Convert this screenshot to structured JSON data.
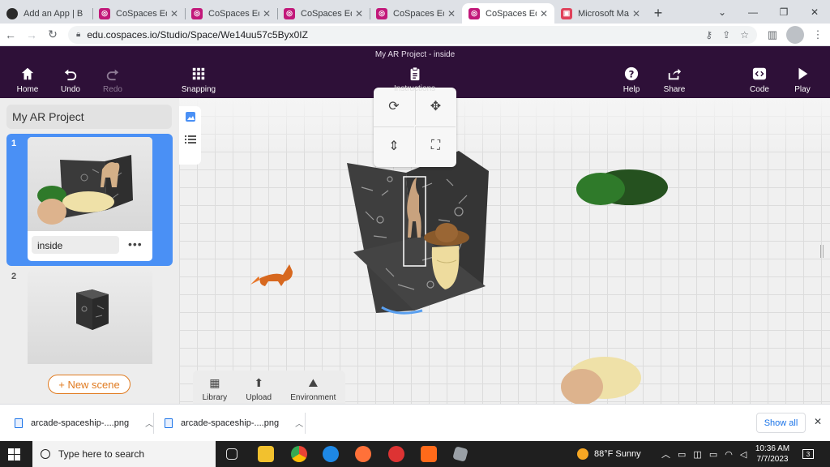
{
  "browser": {
    "tabs": [
      {
        "title": "Add an App | B",
        "favicon": "app-icon",
        "active": false
      },
      {
        "title": "CoSpaces Edu",
        "favicon": "cospaces-icon",
        "active": false
      },
      {
        "title": "CoSpaces Edu",
        "favicon": "cospaces-icon",
        "active": false
      },
      {
        "title": "CoSpaces Edu",
        "favicon": "cospaces-icon",
        "active": false
      },
      {
        "title": "CoSpaces Edu",
        "favicon": "cospaces-icon",
        "active": false
      },
      {
        "title": "CoSpaces Edu",
        "favicon": "cospaces-icon",
        "active": true
      },
      {
        "title": "Microsoft Mak",
        "favicon": "microsoft-icon",
        "active": false
      }
    ],
    "url": "edu.cospaces.io/Studio/Space/We14uu57c5Byx0IZ"
  },
  "header": {
    "project_scene_title": "My AR Project - inside",
    "home": "Home",
    "undo": "Undo",
    "redo": "Redo",
    "snapping": "Snapping",
    "instructions": "Instructions",
    "help": "Help",
    "share": "Share",
    "code": "Code",
    "play": "Play"
  },
  "left_panel": {
    "project_title": "My AR Project",
    "scenes": [
      {
        "number": "1",
        "name": "inside",
        "selected": true
      },
      {
        "number": "2",
        "name": "",
        "selected": false
      }
    ],
    "new_scene": "+ New scene"
  },
  "bottom_bar": {
    "library": "Library",
    "upload": "Upload",
    "environment": "Environment"
  },
  "downloads": {
    "items": [
      {
        "name": "arcade-spaceship-....png"
      },
      {
        "name": "arcade-spaceship-....png"
      }
    ],
    "show_all": "Show all"
  },
  "taskbar": {
    "search_placeholder": "Type here to search",
    "weather": "88°F  Sunny",
    "time": "10:36 AM",
    "date": "7/7/2023",
    "notifications": "3"
  },
  "colors": {
    "header_bg": "#2e1038",
    "scene_selected": "#4a90f5",
    "accent_orange": "#e07a1f"
  }
}
